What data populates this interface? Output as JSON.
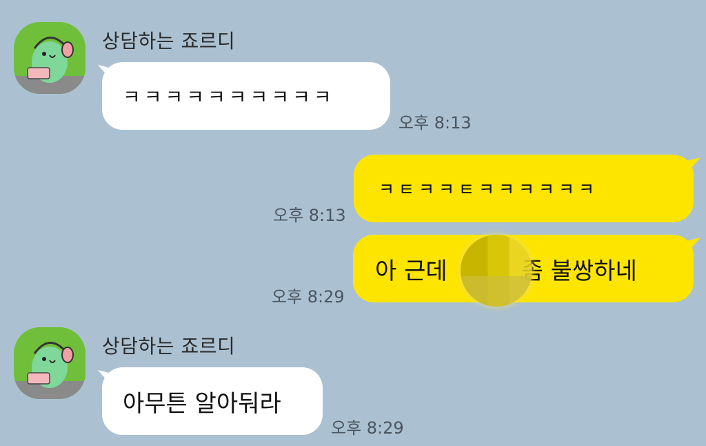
{
  "messages": [
    {
      "sender": "상담하는 죠르디",
      "text": "ㅋㅋㅋㅋㅋㅋㅋㅋㅋㅋ",
      "time": "오후 8:13"
    },
    {
      "text": "ㅋㅌㅋㅋㅌㅋㅋㅋㅋㅋㅋ",
      "time": "오후 8:13"
    },
    {
      "text_before": "아 근데",
      "text_after": "좀 불쌍하네",
      "time": "오후 8:29"
    },
    {
      "sender": "상담하는 죠르디",
      "text": "아무튼 알아둬라",
      "time": "오후 8:29"
    }
  ],
  "colors": {
    "background": "#abc1d1",
    "incoming_bubble": "#ffffff",
    "outgoing_bubble": "#fee500"
  },
  "icons": {
    "avatar": "jordy-dinosaur-with-headset-avatar"
  }
}
